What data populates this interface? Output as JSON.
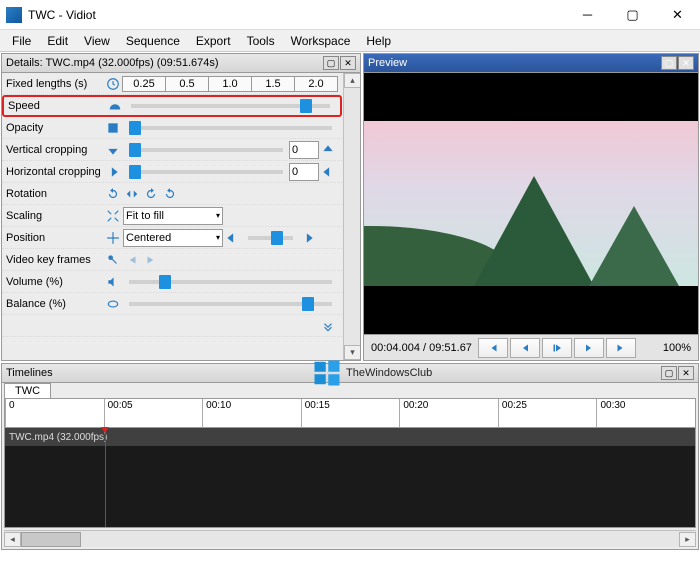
{
  "window": {
    "title": "TWC - Vidiot"
  },
  "menu": {
    "file": "File",
    "edit": "Edit",
    "view": "View",
    "sequence": "Sequence",
    "export": "Export",
    "tools": "Tools",
    "workspace": "Workspace",
    "help": "Help"
  },
  "details": {
    "header": "Details: TWC.mp4 (32.000fps) (09:51.674s)",
    "fixed_label": "Fixed lengths (s)",
    "fixed_options": [
      "0.25",
      "0.5",
      "1.0",
      "1.5",
      "2.0"
    ],
    "speed_label": "Speed",
    "opacity_label": "Opacity",
    "vcrop_label": "Vertical cropping",
    "vcrop_value": "0",
    "hcrop_label": "Horizontal cropping",
    "hcrop_value": "0",
    "rotation_label": "Rotation",
    "scaling_label": "Scaling",
    "scaling_value": "Fit to fill",
    "position_label": "Position",
    "position_value": "Centered",
    "vkey_label": "Video key frames",
    "volume_label": "Volume (%)",
    "balance_label": "Balance (%)"
  },
  "preview": {
    "header": "Preview",
    "timecode": "00:04.004 / 09:51.67",
    "zoom": "100%"
  },
  "timelines": {
    "header": "Timelines",
    "tab": "TWC",
    "ruler": [
      "0",
      "00:05",
      "00:10",
      "00:15",
      "00:20",
      "00:25",
      "00:30"
    ],
    "clip": "TWC.mp4 (32.000fps)"
  },
  "watermark": "TheWindowsClub"
}
